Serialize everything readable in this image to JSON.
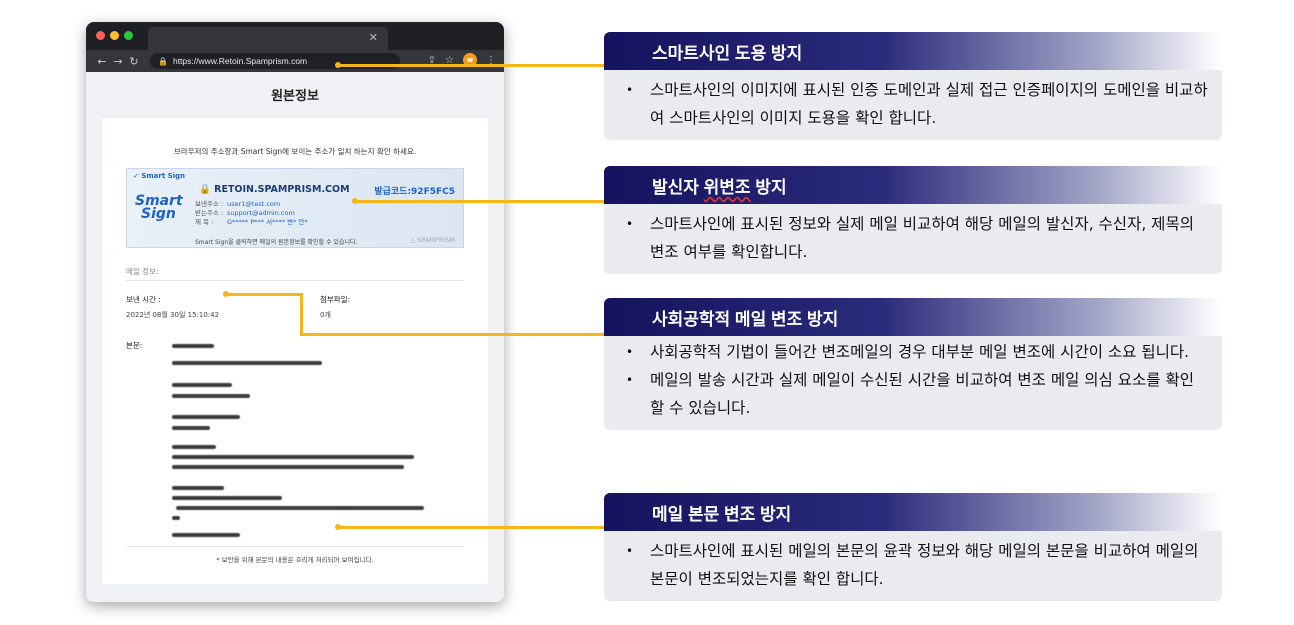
{
  "browser": {
    "url": "https://www.Retoin.Spamprism.com",
    "avatar_letter": "w",
    "page_title": "원본정보",
    "notice": "브라우저의 주소창과 Smart Sign에 보이는 주소가 일치 하는지 확인 하세요.",
    "smart_sign": {
      "badge": "Smart Sign",
      "logo_line1": "Smart",
      "logo_line2": "Sign",
      "domain": "RETOIN.SPAMPRISM.COM",
      "code": "발급코드:92F5FC5",
      "sender_label": "보낸주소 :",
      "sender_value": "user1@test.com",
      "receiver_label": "받는주소 :",
      "receiver_value": "support@admin.com",
      "subject_label": "제    목 :",
      "subject_value": "G***** P*** 서**** 변* 안*",
      "footer": "Smart Sign을 클릭하면 메일의 원본정보를 확인할 수 있습니다.",
      "brand": "SPAMPRISM"
    },
    "mail_info_label": "메일 정보:",
    "sent_time_label": "보낸 시간 :",
    "sent_time_value": "2022년 08월 30일 15:10:42",
    "attachment_label": "첨부파일:",
    "attachment_value": "0개",
    "body_label": "본문:",
    "footnote": "* 보안을 위해 본문의 내용은 흐리게 처리되어 보여집니다."
  },
  "features": [
    {
      "title": "스마트사인 도용 방지",
      "items": [
        "스마트사인의 이미지에 표시된 인증 도메인과 실제 접근 인증페이지의 도메인을 비교하여 스마트사인의 이미지 도용을 확인 합니다."
      ]
    },
    {
      "title_part1": "발신자 ",
      "title_part2": "위변조",
      "title_part3": " 방지",
      "items": [
        "스마트사인에 표시된 정보와 실제 메일 비교하여 해당 메일의 발신자, 수신자, 제목의 변조 여부를 확인합니다."
      ]
    },
    {
      "title": "사회공학적 메일 변조 방지",
      "items": [
        "사회공학적 기법이 들어간 변조메일의 경우 대부분 메일 변조에 시간이 소요 됩니다.",
        "메일의 발송 시간과 실제 메일이 수신된 시간을 비교하여 변조 메일 의심 요소를 확인 할 수 있습니다."
      ]
    },
    {
      "title": "메일 본문 변조 방지",
      "items": [
        "스마트사인에 표시된 메일의 본문의 윤곽 정보와 해당 메일의 본문을 비교하여 메일의 본문이 변조되었는지를 확인 합니다."
      ]
    }
  ],
  "bullet": "•",
  "colors": {
    "accent": "#f5b718",
    "header_dark": "#13135e",
    "body_bg": "#e9ebef"
  }
}
